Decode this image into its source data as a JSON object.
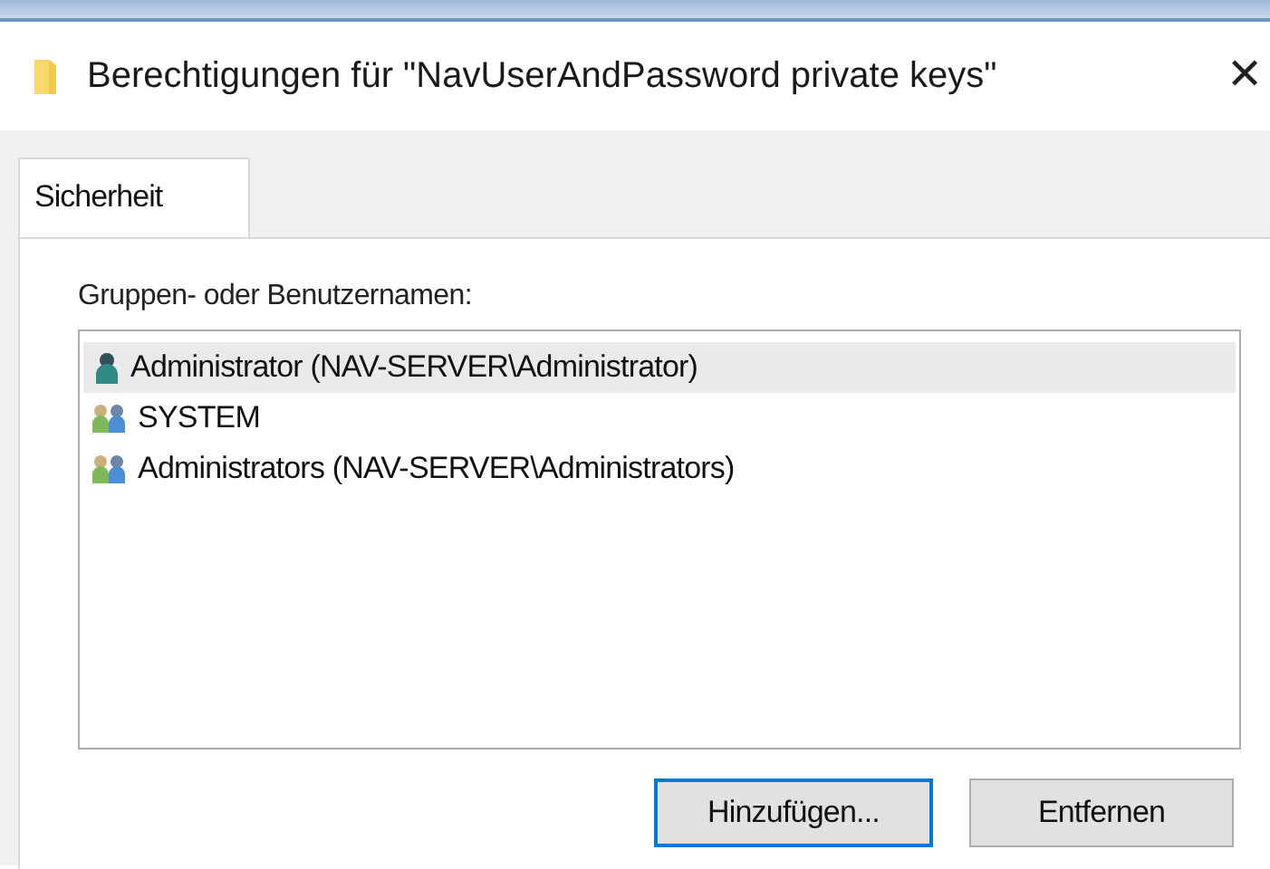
{
  "window": {
    "title": "Berechtigungen für \"NavUserAndPassword private keys\"",
    "close": "✕"
  },
  "tabs": [
    {
      "label": "Sicherheit",
      "selected": true
    }
  ],
  "groups_label": "Gruppen- oder Benutzernamen:",
  "principals": [
    {
      "kind": "user",
      "name": "Administrator (NAV-SERVER\\Administrator)",
      "selected": true
    },
    {
      "kind": "group",
      "name": "SYSTEM",
      "selected": false
    },
    {
      "kind": "group",
      "name": "Administrators (NAV-SERVER\\Administrators)",
      "selected": false
    }
  ],
  "buttons": [
    {
      "label": "Hinzufügen...",
      "focused": true
    },
    {
      "label": "Entfernen",
      "focused": false
    }
  ]
}
